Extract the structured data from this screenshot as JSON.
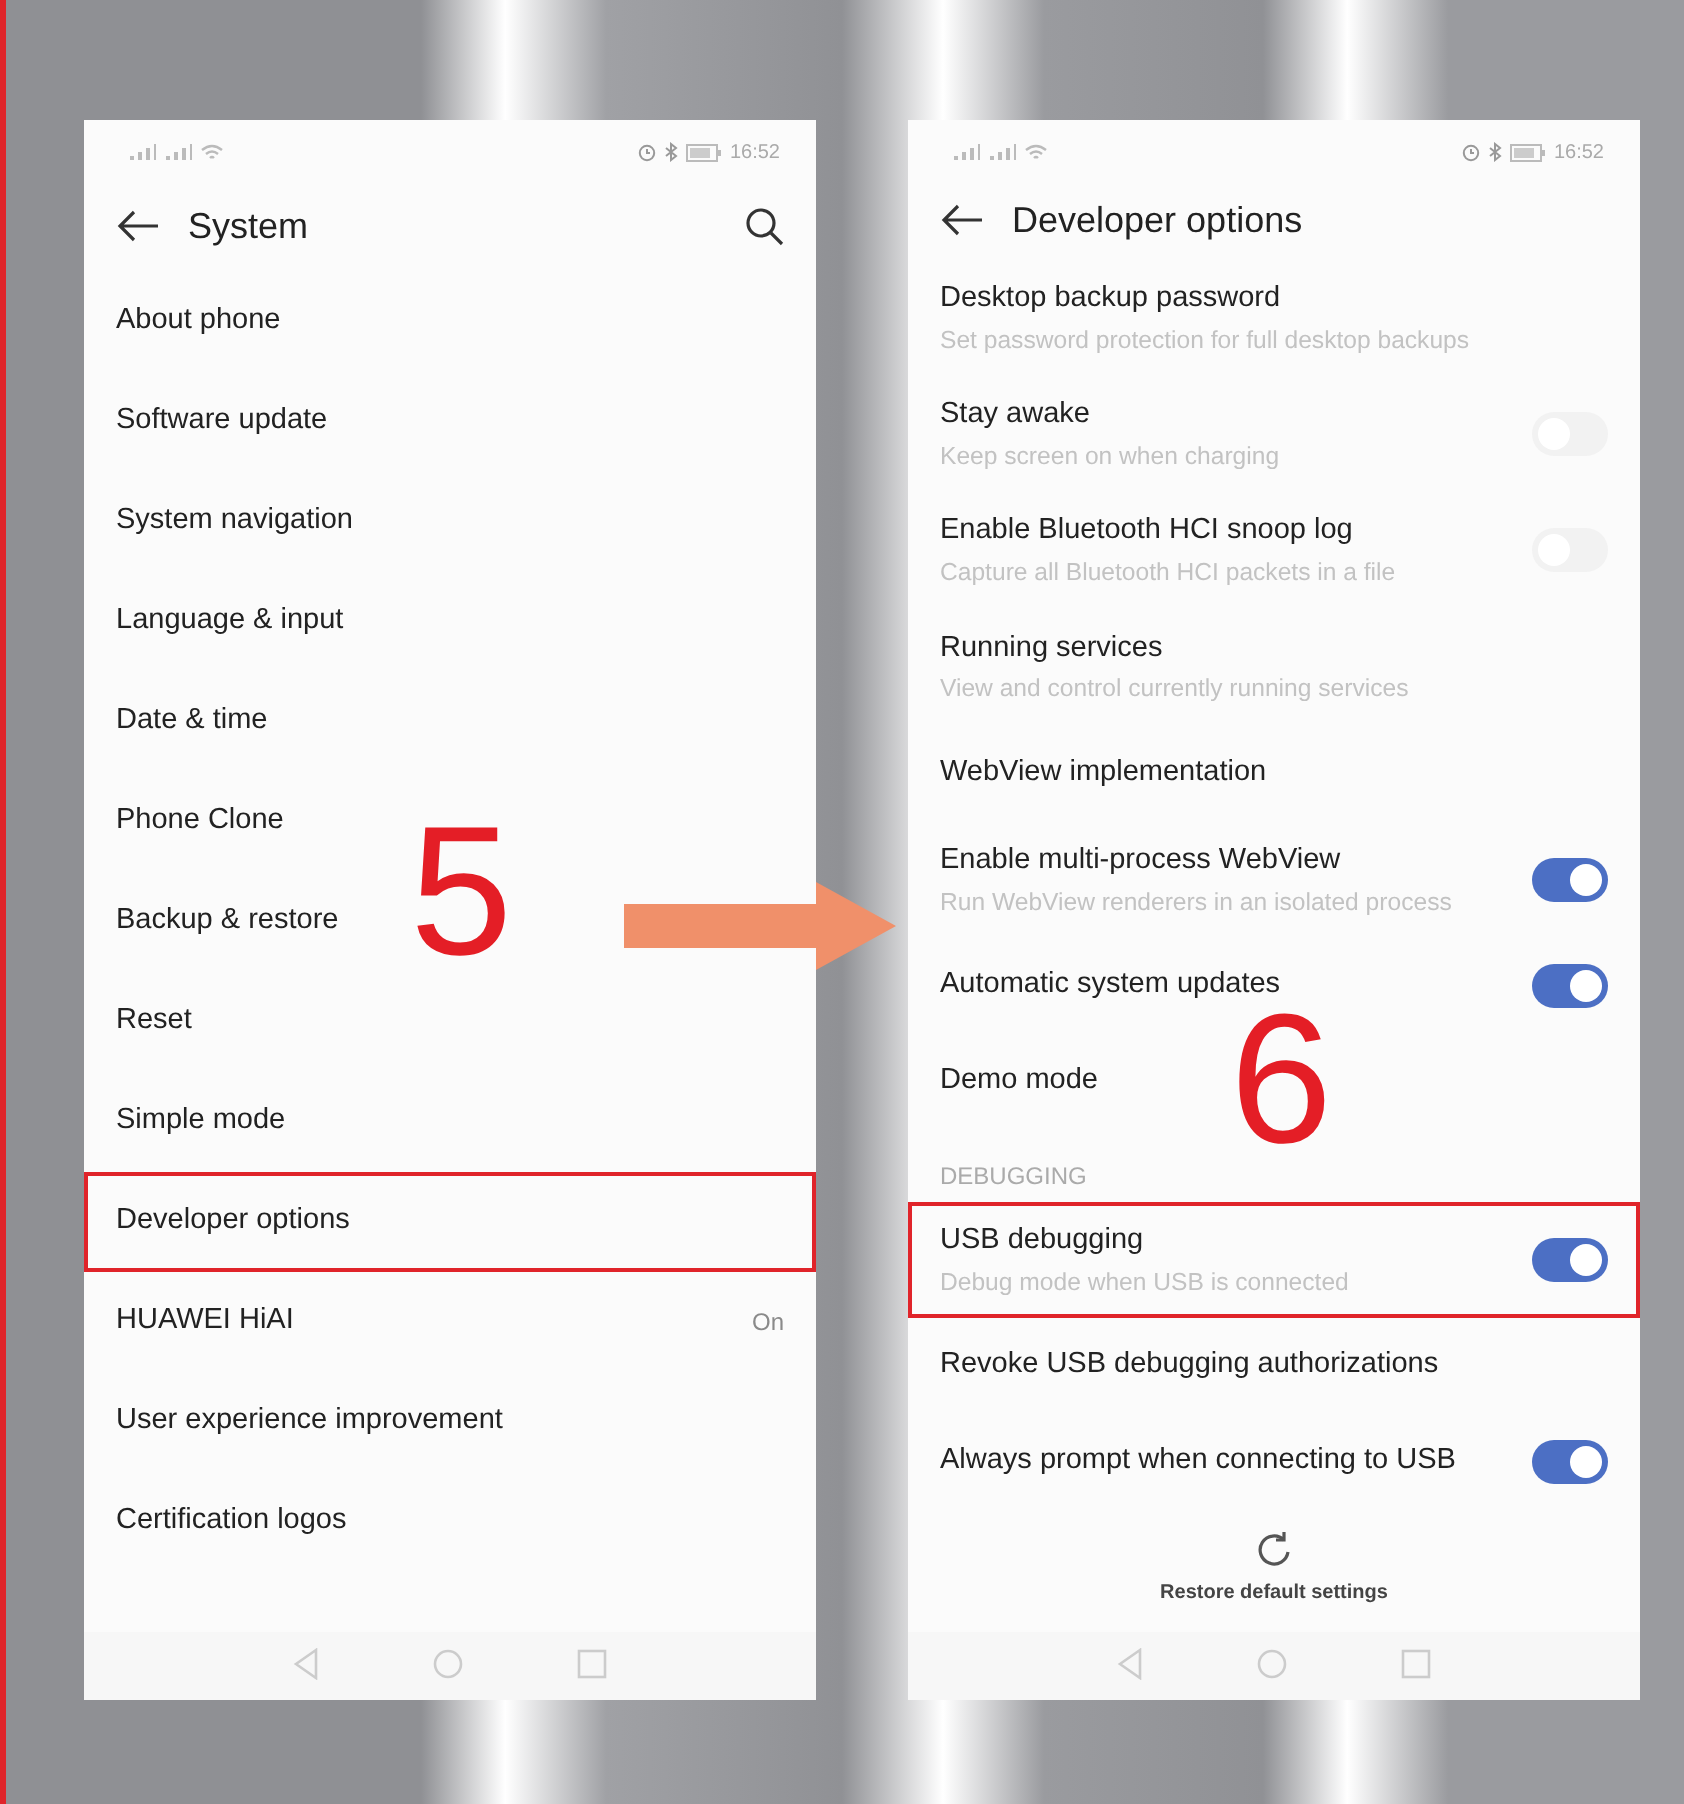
{
  "steps": [
    {
      "number": "5"
    },
    {
      "number": "6"
    }
  ],
  "left_screen": {
    "status_bar": {
      "time": "16:52"
    },
    "title": "System",
    "items": [
      {
        "label": "About phone",
        "highlighted": false
      },
      {
        "label": "Software update",
        "highlighted": false
      },
      {
        "label": "System navigation",
        "highlighted": false
      },
      {
        "label": "Language & input",
        "highlighted": false
      },
      {
        "label": "Date & time",
        "highlighted": false
      },
      {
        "label": "Phone Clone",
        "highlighted": false
      },
      {
        "label": "Backup & restore",
        "highlighted": false
      },
      {
        "label": "Reset",
        "highlighted": false
      },
      {
        "label": "Simple mode",
        "highlighted": false
      },
      {
        "label": "Developer options",
        "highlighted": true
      },
      {
        "label": "HUAWEI HiAI",
        "value": "On",
        "highlighted": false
      },
      {
        "label": "User experience improvement",
        "highlighted": false
      },
      {
        "label": "Certification logos",
        "highlighted": false
      }
    ]
  },
  "right_screen": {
    "status_bar": {
      "time": "16:52"
    },
    "title": "Developer options",
    "items": [
      {
        "kind": "setting",
        "label": "Desktop backup password",
        "description": "Set password protection for full desktop backups",
        "highlighted": false
      },
      {
        "kind": "toggle",
        "label": "Stay awake",
        "description": "Keep screen on when charging",
        "on": false,
        "highlighted": false
      },
      {
        "kind": "toggle",
        "label": "Enable Bluetooth HCI snoop log",
        "description": "Capture all Bluetooth HCI packets in a file",
        "on": false,
        "highlighted": false
      },
      {
        "kind": "setting",
        "label": "Running services",
        "description": "View and control currently running services",
        "highlighted": false
      },
      {
        "kind": "setting",
        "label": "WebView implementation",
        "highlighted": false
      },
      {
        "kind": "toggle",
        "label": "Enable multi-process WebView",
        "description": "Run WebView renderers in an isolated process",
        "on": true,
        "highlighted": false
      },
      {
        "kind": "toggle",
        "label": "Automatic system updates",
        "on": true,
        "highlighted": false
      },
      {
        "kind": "setting",
        "label": "Demo mode",
        "highlighted": false
      },
      {
        "kind": "section",
        "label": "DEBUGGING"
      },
      {
        "kind": "toggle",
        "label": "USB debugging",
        "description": "Debug mode when USB is connected",
        "on": true,
        "highlighted": true
      },
      {
        "kind": "setting",
        "label": "Revoke USB debugging authorizations",
        "highlighted": false
      },
      {
        "kind": "toggle",
        "label": "Always prompt when connecting to USB",
        "on": true,
        "highlighted": false
      }
    ],
    "footer_button": "Restore default settings"
  }
}
